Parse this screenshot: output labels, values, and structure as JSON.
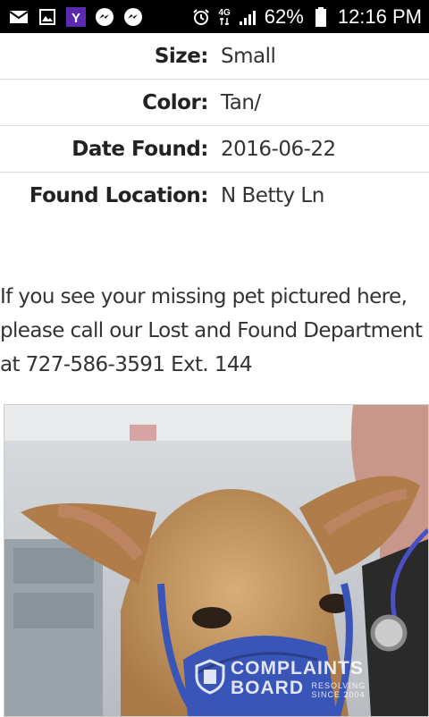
{
  "status_bar": {
    "left_icons": [
      "mail-icon",
      "gallery-icon",
      "yahoo-icon",
      "messenger-icon",
      "messenger-icon"
    ],
    "network_label": "4G",
    "battery": "62%",
    "time": "12:16 PM"
  },
  "details": [
    {
      "label": "Size:",
      "value": "Small"
    },
    {
      "label": "Color:",
      "value": "Tan/"
    },
    {
      "label": "Date Found:",
      "value": "2016-06-22"
    },
    {
      "label": "Found Location:",
      "value": "N Betty Ln"
    }
  ],
  "notice": "If you see your missing pet pictured here, please call our Lost and Found Department at 727-586-3591 Ext. 144",
  "watermark": {
    "line1": "COMPLAINTS",
    "line2": "BOARD",
    "tagline_top": "RESOLVING",
    "tagline_bottom": "SINCE 2004"
  },
  "colors": {
    "status_bar_bg": "#000000",
    "muzzle": "#3a55b8",
    "dog_fur": "#c79a66"
  }
}
